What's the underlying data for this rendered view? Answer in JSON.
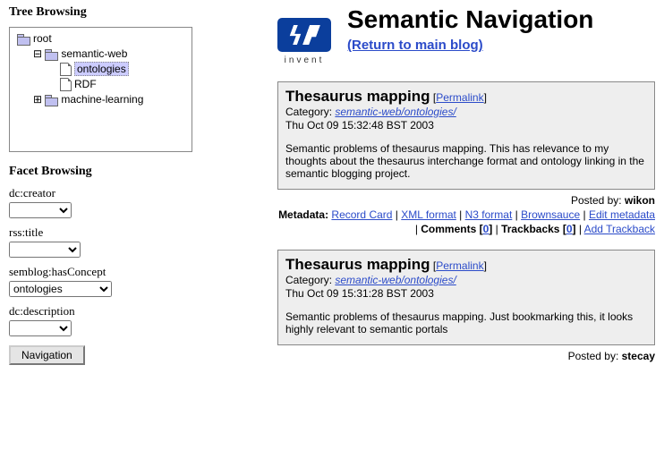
{
  "left": {
    "treeHeading": "Tree Browsing",
    "tree": {
      "root": "root",
      "node1": "semantic-web",
      "leaf1": "ontologies",
      "leaf2": "RDF",
      "node2": "machine-learning"
    },
    "facetHeading": "Facet Browsing",
    "facets": {
      "creatorLabel": "dc:creator",
      "creatorValue": "",
      "titleLabel": "rss:title",
      "titleValue": "",
      "conceptLabel": "semblog:hasConcept",
      "conceptValue": "ontologies",
      "descLabel": "dc:description",
      "descValue": ""
    },
    "navBtn": "Navigation"
  },
  "header": {
    "logoWord": "invent",
    "title": "Semantic Navigation",
    "return": "(Return to main blog)"
  },
  "entries": [
    {
      "title": "Thesaurus mapping",
      "permalink": "Permalink",
      "catLabel": "Category:",
      "catValue": "semantic-web/ontologies/",
      "date": "Thu Oct 09 15:32:48 BST 2003",
      "body": "Semantic problems of thesaurus mapping. This has relevance to my thoughts about the thesaurus interchange format and ontology linking in the semantic blogging project.",
      "postedByLabel": "Posted by:",
      "author": "wikon",
      "meta": {
        "label": "Metadata:",
        "record": "Record Card",
        "xml": "XML format",
        "n3": "N3 format",
        "brown": "Brownsauce",
        "edit": "Edit metadata",
        "commentsLabel": "Comments [",
        "commentsCount": "0",
        "commentsClose": "]",
        "tbLabel": "Trackbacks [",
        "tbCount": "0",
        "tbClose": "]",
        "addTb": "Add Trackback"
      }
    },
    {
      "title": "Thesaurus mapping",
      "permalink": "Permalink",
      "catLabel": "Category:",
      "catValue": "semantic-web/ontologies/",
      "date": "Thu Oct 09 15:31:28 BST 2003",
      "body": "Semantic problems of thesaurus mapping. Just bookmarking this, it looks highly relevant to semantic portals",
      "postedByLabel": "Posted by:",
      "author": "stecay"
    }
  ],
  "sep": " | "
}
